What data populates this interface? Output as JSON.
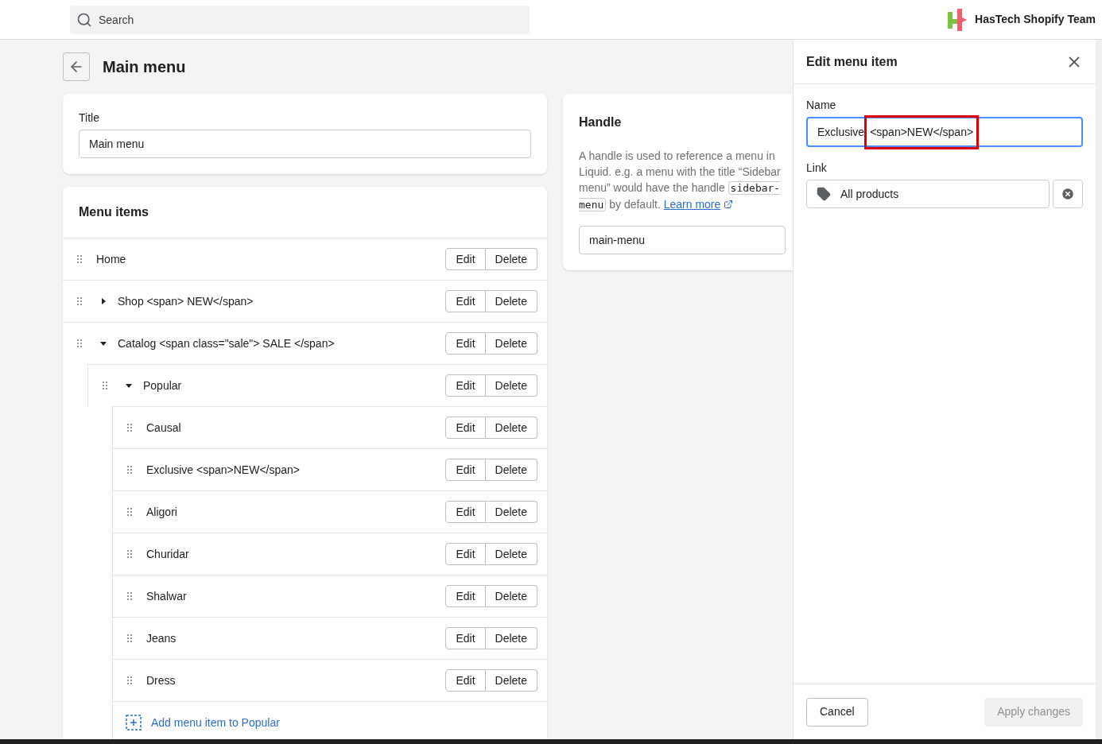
{
  "topbar": {
    "search": {
      "placeholder": "Search"
    },
    "store_name": "HasTech Shopify Team"
  },
  "page": {
    "title": "Main menu"
  },
  "title_card": {
    "label": "Title",
    "value": "Main menu"
  },
  "menu_card": {
    "title": "Menu items",
    "items": [
      {
        "name": "Home",
        "edit_label": "Edit",
        "delete_label": "Delete"
      },
      {
        "name": "Shop <span> NEW</span>",
        "edit_label": "Edit",
        "delete_label": "Delete",
        "expanded": false
      },
      {
        "name": "Catalog <span class=\"sale\"> SALE </span>",
        "edit_label": "Edit",
        "delete_label": "Delete",
        "expanded": true,
        "children": [
          {
            "name": "Popular",
            "edit_label": "Edit",
            "delete_label": "Delete",
            "expanded": true,
            "add_label": "Add menu item to Popular",
            "children": [
              {
                "name": "Causal",
                "edit_label": "Edit",
                "delete_label": "Delete"
              },
              {
                "name": "Exclusive <span>NEW</span>",
                "edit_label": "Edit",
                "delete_label": "Delete"
              },
              {
                "name": "Aligori",
                "edit_label": "Edit",
                "delete_label": "Delete"
              },
              {
                "name": "Churidar",
                "edit_label": "Edit",
                "delete_label": "Delete"
              },
              {
                "name": "Shalwar",
                "edit_label": "Edit",
                "delete_label": "Delete"
              },
              {
                "name": "Jeans",
                "edit_label": "Edit",
                "delete_label": "Delete"
              },
              {
                "name": "Dress",
                "edit_label": "Edit",
                "delete_label": "Delete"
              }
            ]
          }
        ]
      }
    ]
  },
  "handle_card": {
    "title": "Handle",
    "text_before": "A handle is used to reference a menu in Liquid. e.g. a menu with the title “Sidebar menu” would have the handle",
    "code": "sidebar-menu",
    "text_after": "by default.",
    "link": "Learn more",
    "value": "main-menu"
  },
  "edit_panel": {
    "title": "Edit menu item",
    "name_label": "Name",
    "name_value": "Exclusive",
    "name_value_highlighted": "<span>NEW</span>",
    "highlighted": true,
    "link_label": "Link",
    "link_value": "All products",
    "cancel": "Cancel",
    "apply": "Apply changes",
    "apply_disabled": true
  }
}
